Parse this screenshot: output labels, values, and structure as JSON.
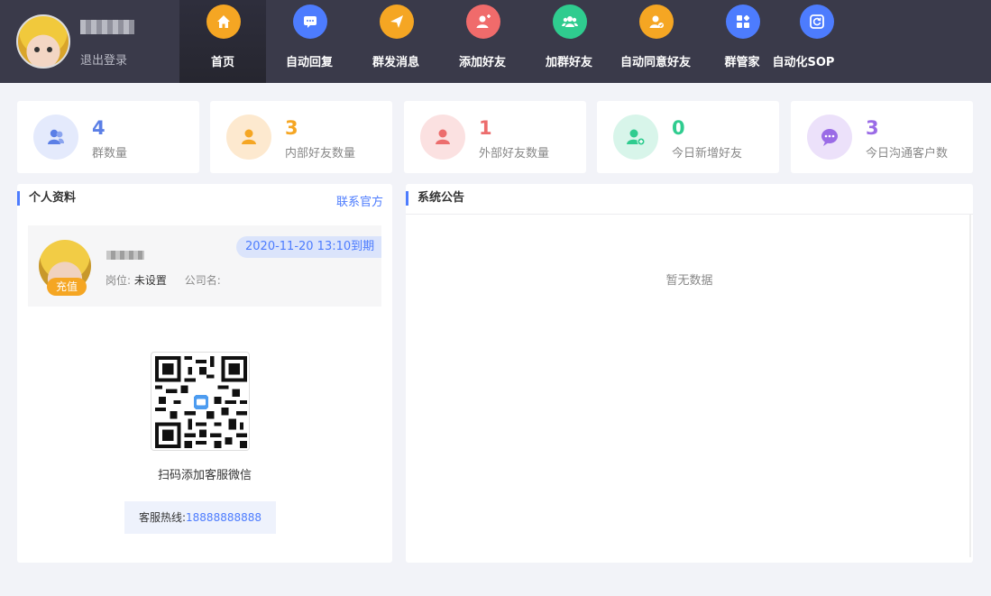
{
  "header": {
    "logout_label": "退出登录"
  },
  "nav": [
    {
      "label": "首页",
      "icon": "home-icon",
      "color": "#f5a623"
    },
    {
      "label": "自动回复",
      "icon": "chat-icon",
      "color": "#4d7cfe"
    },
    {
      "label": "群发消息",
      "icon": "send-icon",
      "color": "#f5a623"
    },
    {
      "label": "添加好友",
      "icon": "add-user-icon",
      "color": "#f06b6b"
    },
    {
      "label": "加群好友",
      "icon": "group-icon",
      "color": "#2fcc8f"
    },
    {
      "label": "自动同意好友",
      "icon": "user-check-icon",
      "color": "#f5a623"
    },
    {
      "label": "群管家",
      "icon": "grid-icon",
      "color": "#4d7cfe"
    },
    {
      "label": "自动化SOP",
      "icon": "refresh-icon",
      "color": "#4d7cfe"
    }
  ],
  "stats": [
    {
      "value": "4",
      "label": "群数量",
      "color": "#5b7fe6",
      "bg": "#e4eafc",
      "icon": "group-icon"
    },
    {
      "value": "3",
      "label": "内部好友数量",
      "color": "#f5a623",
      "bg": "#fde9cf",
      "icon": "user-icon"
    },
    {
      "value": "1",
      "label": "外部好友数量",
      "color": "#ec6d6d",
      "bg": "#fbe1e1",
      "icon": "user-icon"
    },
    {
      "value": "0",
      "label": "今日新增好友",
      "color": "#2fcc8f",
      "bg": "#d8f5ea",
      "icon": "add-user-icon"
    },
    {
      "value": "3",
      "label": "今日沟通客户数",
      "color": "#9a6be6",
      "bg": "#ece1fa",
      "icon": "message-icon"
    }
  ],
  "profile_panel": {
    "title": "个人资料",
    "contact_link": "联系官方",
    "expire": "2020-11-20 13:10到期",
    "recharge": "充值",
    "position_label": "岗位:",
    "position_value": "未设置",
    "company_label": "公司名:",
    "company_value": "",
    "qr_caption": "扫码添加客服微信",
    "hotline_label": "客服热线:",
    "hotline_number": "18888888888"
  },
  "notice_panel": {
    "title": "系统公告",
    "empty_text": "暂无数据"
  }
}
